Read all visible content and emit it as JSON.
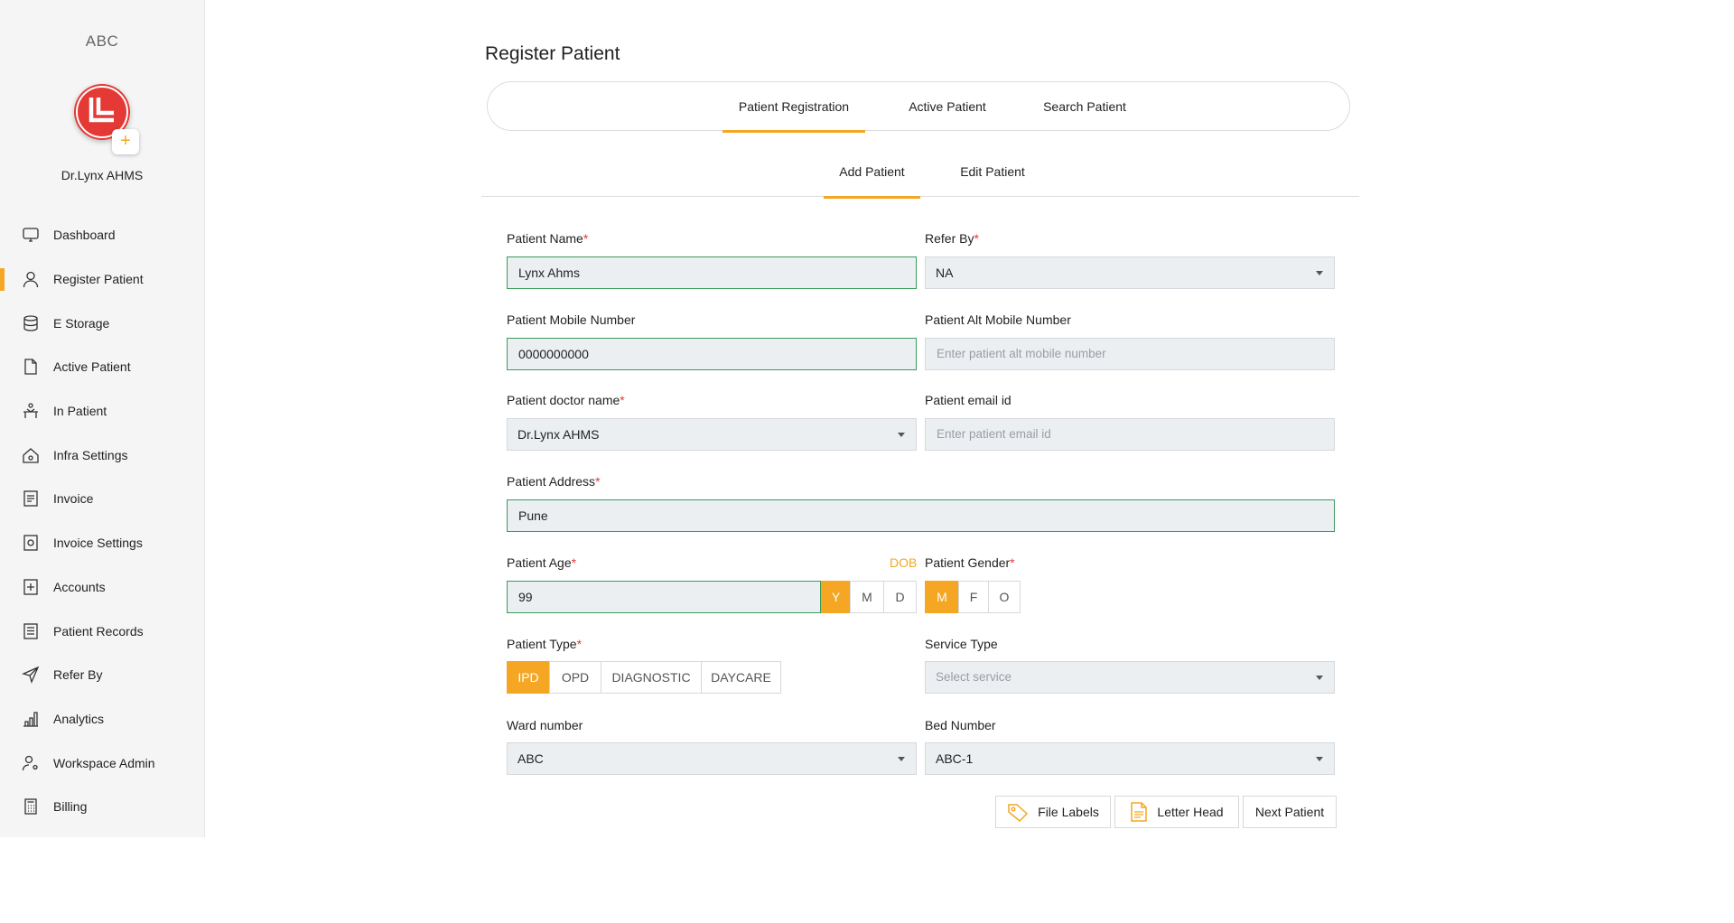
{
  "sidebar": {
    "org_name": "ABC",
    "user_name": "Dr.Lynx AHMS",
    "avatar_add": "+",
    "items": [
      {
        "label": "Dashboard",
        "icon": "monitor-icon"
      },
      {
        "label": "Register Patient",
        "icon": "user-icon",
        "active": true
      },
      {
        "label": "E Storage",
        "icon": "database-icon"
      },
      {
        "label": "Active Patient",
        "icon": "file-icon"
      },
      {
        "label": "In Patient",
        "icon": "bed-patient-icon"
      },
      {
        "label": "Infra Settings",
        "icon": "home-gear-icon"
      },
      {
        "label": "Invoice",
        "icon": "invoice-icon"
      },
      {
        "label": "Invoice Settings",
        "icon": "invoice-settings-icon"
      },
      {
        "label": "Accounts",
        "icon": "accounts-icon"
      },
      {
        "label": "Patient Records",
        "icon": "records-icon"
      },
      {
        "label": "Refer By",
        "icon": "send-icon"
      },
      {
        "label": "Analytics",
        "icon": "bar-chart-icon"
      },
      {
        "label": "Workspace Admin",
        "icon": "user-settings-icon"
      },
      {
        "label": "Billing",
        "icon": "calculator-icon"
      }
    ]
  },
  "page_title": "Register Patient",
  "tabs": [
    "Patient Registration",
    "Active Patient",
    "Search Patient"
  ],
  "sub_tabs": [
    "Add Patient",
    "Edit Patient"
  ],
  "form": {
    "patient_name": {
      "label": "Patient Name",
      "value": "Lynx Ahms"
    },
    "refer_by": {
      "label": "Refer By",
      "value": "NA"
    },
    "mobile": {
      "label": "Patient Mobile Number",
      "value": "0000000000"
    },
    "alt_mobile": {
      "label": "Patient Alt Mobile Number",
      "placeholder": "Enter patient alt mobile number"
    },
    "doctor": {
      "label": "Patient doctor name",
      "value": "Dr.Lynx AHMS"
    },
    "email": {
      "label": "Patient email id",
      "placeholder": "Enter patient email id"
    },
    "address": {
      "label": "Patient Address",
      "value": "Pune"
    },
    "age": {
      "label": "Patient Age",
      "value": "99",
      "dob_link": "DOB",
      "units": [
        "Y",
        "M",
        "D"
      ],
      "selected_unit": "Y"
    },
    "gender": {
      "label": "Patient Gender",
      "options": [
        "M",
        "F",
        "O"
      ],
      "selected": "M"
    },
    "patient_type": {
      "label": "Patient Type",
      "options": [
        "IPD",
        "OPD",
        "DIAGNOSTIC",
        "DAYCARE"
      ],
      "selected": "IPD"
    },
    "service_type": {
      "label": "Service Type",
      "placeholder": "Select service"
    },
    "ward": {
      "label": "Ward number",
      "value": "ABC"
    },
    "bed": {
      "label": "Bed Number",
      "value": "ABC-1"
    }
  },
  "required_mark": "*",
  "actions": {
    "file_labels": "File Labels",
    "letter_head": "Letter Head",
    "next_patient": "Next Patient"
  },
  "colors": {
    "accent": "#f5a623",
    "valid_border": "#3a9b5a",
    "required": "#e53935",
    "avatar": "#e53935"
  }
}
